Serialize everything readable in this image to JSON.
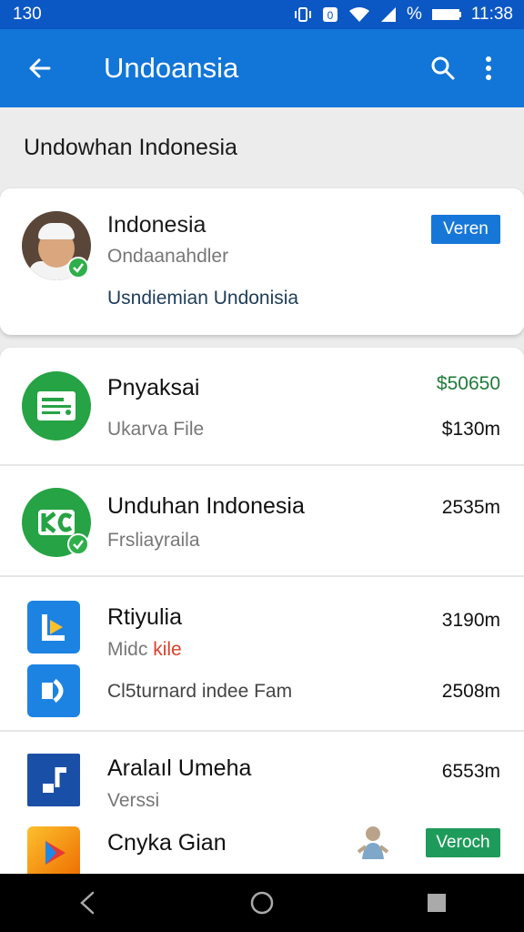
{
  "status_bar": {
    "left_text": "130",
    "time": "11:38",
    "percent": "%",
    "icons": [
      "vibrate-icon",
      "notification-icon",
      "wifi-icon",
      "signal-icon",
      "battery-icon"
    ]
  },
  "app_bar": {
    "title": "Undoansia",
    "back_icon": "arrow-back-icon",
    "search_icon": "search-icon",
    "more_icon": "more-vert-icon"
  },
  "section_header": {
    "label": "Undowhan Indonesia"
  },
  "profile": {
    "name": "Indonesia",
    "subtitle": "Ondaanahdler",
    "line": "Usndiemian Undonisia",
    "verify_label": "Veren"
  },
  "items": [
    {
      "title": "Pnyaksai",
      "subtitle": "Ukarva File",
      "value_top": "$50650",
      "value_bottom": "$130m",
      "icon": "document-icon"
    },
    {
      "title": "Unduhan Indonesia",
      "subtitle": "Frsliayraila",
      "value_top": "2535m",
      "icon": "app-kc-icon"
    },
    {
      "title": "Rtiyulia",
      "subtitle_a": "Midc",
      "subtitle_b": "kile",
      "value_top": "3190m",
      "icon": "app-l-icon"
    },
    {
      "title": "",
      "subtitle": "Cl5turnard indee Fam",
      "value_top": "2508m",
      "icon": "app-d-icon"
    },
    {
      "title": "Aralaıl Umeha",
      "subtitle": "Verssi",
      "value_top": "6553m",
      "icon": "music-icon"
    },
    {
      "title": "Cnyka Gian",
      "subtitle": "",
      "verify_label": "Veroch",
      "icon": "play-store-icon"
    }
  ],
  "colors": {
    "status_bar": "#0b57c4",
    "app_bar": "#1275d8",
    "accent_green": "#26a344",
    "verify_blue": "#1677d8",
    "verify_green": "#1e9b5a"
  },
  "nav_bar": {
    "icons": [
      "nav-back-icon",
      "nav-home-icon",
      "nav-recents-icon"
    ]
  }
}
